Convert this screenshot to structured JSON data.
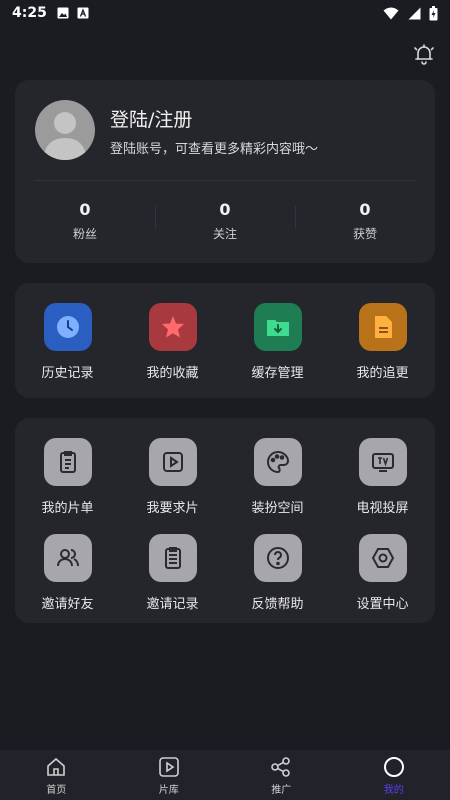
{
  "status_bar": {
    "time": "4:25"
  },
  "profile": {
    "title": "登陆/注册",
    "subtitle": "登陆账号，可查看更多精彩内容哦～",
    "stats": [
      {
        "value": "0",
        "label": "粉丝"
      },
      {
        "value": "0",
        "label": "关注"
      },
      {
        "value": "0",
        "label": "获赞"
      }
    ]
  },
  "quick_actions": [
    {
      "label": "历史记录",
      "icon": "clock-icon",
      "color": "#2a5ec0"
    },
    {
      "label": "我的收藏",
      "icon": "star-icon",
      "color": "#c94a4a"
    },
    {
      "label": "缓存管理",
      "icon": "download-folder-icon",
      "color": "#25a364"
    },
    {
      "label": "我的追更",
      "icon": "document-icon",
      "color": "#e49420"
    }
  ],
  "tools": [
    {
      "label": "我的片单",
      "icon": "clipboard-icon"
    },
    {
      "label": "我要求片",
      "icon": "play-icon"
    },
    {
      "label": "装扮空间",
      "icon": "palette-icon"
    },
    {
      "label": "电视投屏",
      "icon": "tv-icon"
    },
    {
      "label": "邀请好友",
      "icon": "users-icon"
    },
    {
      "label": "邀请记录",
      "icon": "list-icon"
    },
    {
      "label": "反馈帮助",
      "icon": "help-icon"
    },
    {
      "label": "设置中心",
      "icon": "settings-icon"
    }
  ],
  "tabbar": [
    {
      "label": "首页",
      "icon": "home-icon"
    },
    {
      "label": "片库",
      "icon": "library-icon"
    },
    {
      "label": "推广",
      "icon": "share-icon"
    },
    {
      "label": "我的",
      "icon": "profile-circle-icon",
      "active": true
    }
  ],
  "colors": {
    "accent": "#5b3df0",
    "card": "#25262c",
    "background": "#1b1c21"
  }
}
